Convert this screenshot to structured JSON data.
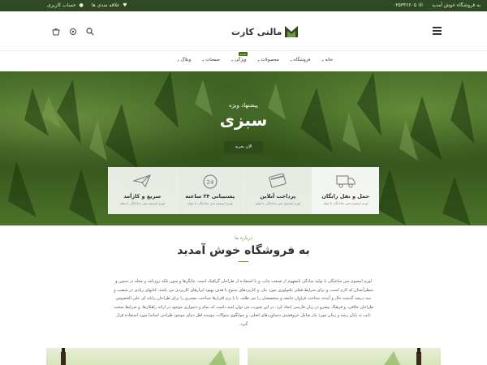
{
  "topbar": {
    "welcome": "به فروشگاه خوش آمدید",
    "phone": "۰۳۵۳۴۶۶۰۵",
    "wishlist": "علاقه مندی ها",
    "account": "حساب کاربری"
  },
  "header": {
    "logo_text": "مالتی کارت",
    "icons": [
      "menu-icon",
      "search-icon",
      "settings-icon",
      "cart-icon"
    ]
  },
  "nav": {
    "items": [
      {
        "label": "خانه",
        "has_dropdown": true
      },
      {
        "label": "فروشگاه",
        "has_dropdown": true
      },
      {
        "label": "محصولات",
        "has_dropdown": true
      },
      {
        "label": "ویژگی",
        "has_dropdown": true,
        "badge": "جدید"
      },
      {
        "label": "صفحات",
        "has_dropdown": true
      },
      {
        "label": "وبلاگ",
        "has_dropdown": true
      }
    ]
  },
  "hero": {
    "subtitle": "پیشنهاد ویژه",
    "title": "سبزی",
    "button": "الان بخرید"
  },
  "features": [
    {
      "title": "حمل و نقل رایگان",
      "desc": "لورم ایپسوم متن ساختگی با تولید",
      "icon": "truck-icon"
    },
    {
      "title": "پرداخت آنلاین",
      "desc": "لورم ایپسوم متن ساختگی با تولید",
      "icon": "credit-card-icon"
    },
    {
      "title": "پشتیبانی ۲۴ ساعته",
      "desc": "لورم ایپسوم متن ساختگی با تولید",
      "icon": "support-24-icon"
    },
    {
      "title": "سریع و کارآمد",
      "desc": "لورم ایپسوم متن ساختگی با تولید",
      "icon": "paper-plane-icon"
    }
  ],
  "about": {
    "label": "درباره ما",
    "title": "به فروشگاه خوش آمدید",
    "text": "لورم ایپسوم متن ساختگی با تولید سادگی نامفهوم از صنعت چاپ، و با استفاده از طراحان گرافیک است، چاپگرها و متون بلکه روزنامه و مجله در ستون و سطرآنچنان که لازم است، و برای شرایط فعلی تکنولوژی مورد نیاز، و کاربردهای متنوع با هدف بهبود ابزارهای کاربردی می باشد، کتابهای زیادی در شصت و سه درصد گذشته حال و آینده، شناخت فراوان جامعه و متخصصان را می طلبد، تا با نرم افزارها شناخت بیشتری را برای طراحان رایانه ای علی الخصوص طراحان خلاقی، و فرهنگ پیشرو در زبان فارسی ایجاد کرد، در این صورت می توان امید داشت که تمام و دشواری موجود در ارائه راهکارها، و شرایط سخت تایپ به پایان رسد و زمان مورد نیاز شامل حروفچینی دستاوردهای اصلی، و جوابگوی سوالات پیوسته اهل دنیای موجود طراحی اساسا مورد استفاده قرار گیرد."
  },
  "colors": {
    "topbar_bg": "#2f4a22",
    "accent": "#6a9a3a",
    "button_bg": "#2e4a1d"
  }
}
